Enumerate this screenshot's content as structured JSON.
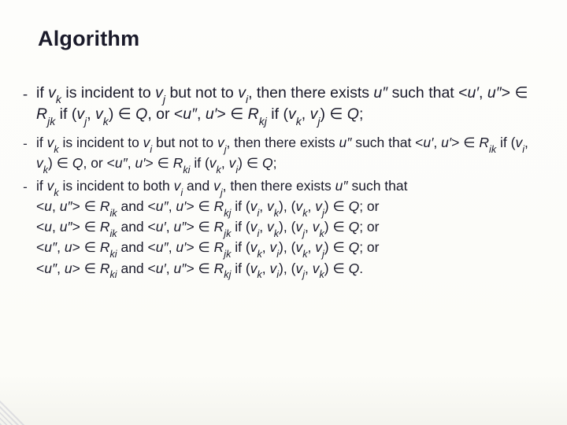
{
  "title": "Algorithm",
  "items": [
    {
      "style": "lead",
      "html": "if <i class='v'>v<sub>k</sub></i> is incident to <i class='v'>v<sub>j</sub></i> but not to <i class='v'>v<sub>i</sub></i>, then there exists <i class='v'>u″</i> such that &lt;<i class='v'>u′</i>, <i class='v'>u″</i>&gt; ∈ <i class='v'>R<sub>jk</sub></i> if (<i class='v'>v<sub>j</sub></i>, <i class='v'>v<sub>k</sub></i>) ∈ <i class='v'>Q</i>, or &lt;<i class='v'>u″</i>, <i class='v'>u′</i>&gt; ∈ <i class='v'>R<sub>kj</sub></i> if (<i class='v'>v<sub>k</sub></i>, <i class='v'>v<sub>j</sub></i>) ∈ <i class='v'>Q</i>;"
    },
    {
      "style": "sub",
      "html": "if <i class='v'>v<sub>k</sub></i> is incident to <i class='v'>v<sub>i</sub></i> but not to <i class='v'>v<sub>j</sub></i>, then there exists <i class='v'>u″</i> such that &lt;<i class='v'>u′</i>, <i class='v'>u′</i>&gt; ∈ <i class='v'>R<sub>ik</sub></i> if (<i class='v'>v<sub>i</sub></i>, <i class='v'>v<sub>k</sub></i>) ∈ <i class='v'>Q</i>, or &lt;<i class='v'>u″</i>, <i class='v'>u′</i>&gt; ∈ <i class='v'>R<sub>ki</sub></i> if (<i class='v'>v<sub>k</sub></i>, <i class='v'>v<sub>i</sub></i>) ∈ <i class='v'>Q</i>;"
    },
    {
      "style": "sub",
      "html": "if <i class='v'>v<sub>k</sub></i> is incident to both <i class='v'>v<sub>i</sub></i> and <i class='v'>v<sub>j</sub></i>, then there exists <i class='v'>u″</i> such that",
      "sublines": [
        "&lt;<i class='v'>u</i>, <i class='v'>u″</i>&gt; ∈ <i class='v'>R<sub>ik</sub></i> and &lt;<i class='v'>u″</i>, <i class='v'>u′</i>&gt; ∈ <i class='v'>R<sub>kj</sub></i> if (<i class='v'>v<sub>i</sub></i>, <i class='v'>v<sub>k</sub></i>), (<i class='v'>v<sub>k</sub></i>, <i class='v'>v<sub>j</sub></i>) ∈ <i class='v'>Q</i>; or",
        "&lt;<i class='v'>u</i>, <i class='v'>u″</i>&gt; ∈ <i class='v'>R<sub>ik</sub></i> and &lt;<i class='v'>u′</i>, <i class='v'>u″</i>&gt; ∈ <i class='v'>R<sub>jk</sub></i> if (<i class='v'>v<sub>i</sub></i>, <i class='v'>v<sub>k</sub></i>), (<i class='v'>v<sub>j</sub></i>, <i class='v'>v<sub>k</sub></i>) ∈ <i class='v'>Q</i>; or",
        "&lt;<i class='v'>u″</i>, <i class='v'>u</i>&gt; ∈ <i class='v'>R<sub>ki</sub></i> and &lt;<i class='v'>u″</i>, <i class='v'>u′</i>&gt; ∈ <i class='v'>R<sub>jk</sub></i> if (<i class='v'>v<sub>k</sub></i>, <i class='v'>v<sub>i</sub></i>), (<i class='v'>v<sub>k</sub></i>, <i class='v'>v<sub>j</sub></i>) ∈ <i class='v'>Q</i>; or",
        "&lt;<i class='v'>u″</i>, <i class='v'>u</i>&gt; ∈ <i class='v'>R<sub>ki</sub></i> and &lt;<i class='v'>u′</i>, <i class='v'>u″</i>&gt; ∈ <i class='v'>R<sub>kj</sub></i> if (<i class='v'>v<sub>k</sub></i>, <i class='v'>v<sub>i</sub></i>), (<i class='v'>v<sub>j</sub></i>, <i class='v'>v<sub>k</sub></i>) ∈ <i class='v'>Q</i>."
      ]
    }
  ]
}
